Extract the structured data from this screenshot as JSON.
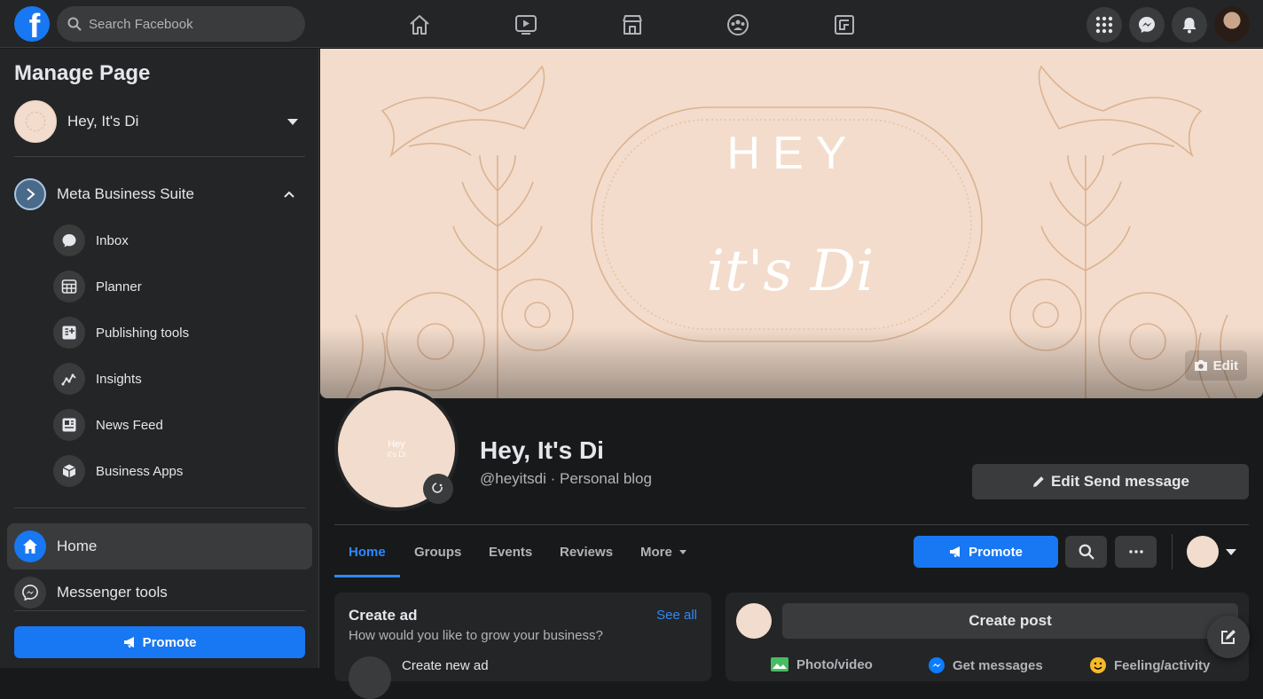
{
  "topbar": {
    "logo_letter": "f",
    "search_placeholder": "Search Facebook",
    "nav_icons": [
      "home-icon",
      "watch-icon",
      "marketplace-icon",
      "groups-icon",
      "gaming-icon"
    ],
    "right_icons": [
      "menu-grid-icon",
      "messenger-icon",
      "notifications-icon"
    ]
  },
  "sidebar": {
    "title": "Manage Page",
    "page_name": "Hey, It's Di",
    "business_suite": "Meta Business Suite",
    "sub_items": [
      {
        "label": "Inbox",
        "icon": "inbox-icon"
      },
      {
        "label": "Planner",
        "icon": "planner-icon"
      },
      {
        "label": "Publishing tools",
        "icon": "publishing-tools-icon"
      },
      {
        "label": "Insights",
        "icon": "insights-icon"
      },
      {
        "label": "News Feed",
        "icon": "news-feed-icon"
      },
      {
        "label": "Business Apps",
        "icon": "business-apps-icon"
      }
    ],
    "home_label": "Home",
    "messenger_tools_label": "Messenger tools",
    "promote_label": "Promote"
  },
  "cover": {
    "edit_label": "Edit",
    "line1": "HEY",
    "line2": "it's Di"
  },
  "profile": {
    "pic_text_1": "Hey",
    "pic_text_2": "it's Di",
    "name": "Hey, It's Di",
    "subtitle": "@heyitsdi · Personal blog",
    "edit_send_label": "Edit Send message"
  },
  "tabs": {
    "items": [
      "Home",
      "Groups",
      "Events",
      "Reviews",
      "More"
    ],
    "promote_label": "Promote"
  },
  "create_ad": {
    "title": "Create ad",
    "subtitle": "How would you like to grow your business?",
    "see_all": "See all",
    "row_label": "Create new ad"
  },
  "create_post": {
    "button_label": "Create post",
    "options": [
      "Photo/video",
      "Get messages",
      "Feeling/activity"
    ]
  },
  "colors": {
    "accent": "#1877f2",
    "link": "#2d88ff",
    "surface": "#242526",
    "background": "#18191a",
    "cover": "#f3dccb"
  }
}
